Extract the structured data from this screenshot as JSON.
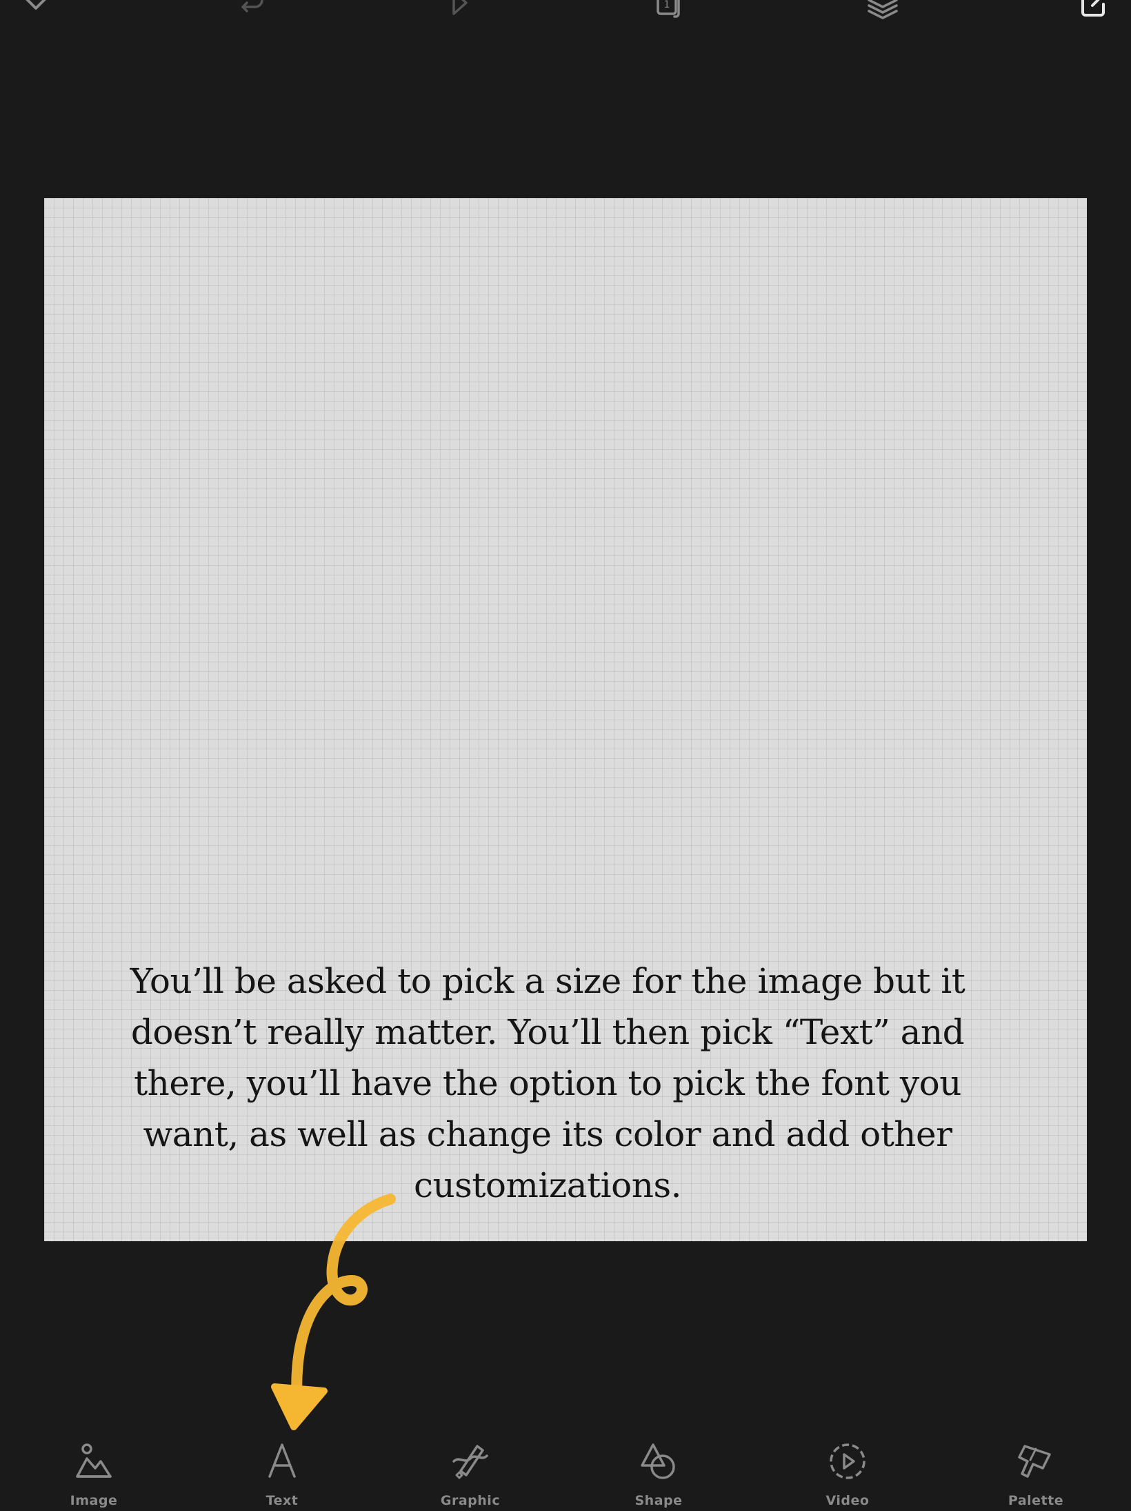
{
  "top_toolbar": {
    "page_count": "1",
    "icons": [
      "chevron-down-icon",
      "undo-icon",
      "play-icon",
      "pages-icon",
      "layers-icon",
      "export-icon"
    ]
  },
  "canvas": {
    "text": "You’ll be asked to pick a size for the image but it\ndoesn’t really matter. You’ll then pick “Text” and\nthere, you’ll have the option to pick the font you\nwant, as well as change its color and add other\ncustomizations."
  },
  "annotation": {
    "color": "#f5b731"
  },
  "bottom_toolbar": {
    "items": [
      {
        "label": "Image",
        "icon": "image-icon"
      },
      {
        "label": "Text",
        "icon": "text-icon"
      },
      {
        "label": "Graphic",
        "icon": "graphic-icon"
      },
      {
        "label": "Shape",
        "icon": "shape-icon"
      },
      {
        "label": "Video",
        "icon": "video-icon"
      },
      {
        "label": "Palette",
        "icon": "palette-icon"
      }
    ]
  },
  "colors": {
    "background": "#1a1a1b",
    "canvas": "#dcdcdc",
    "icon": "#8a8a8a"
  }
}
